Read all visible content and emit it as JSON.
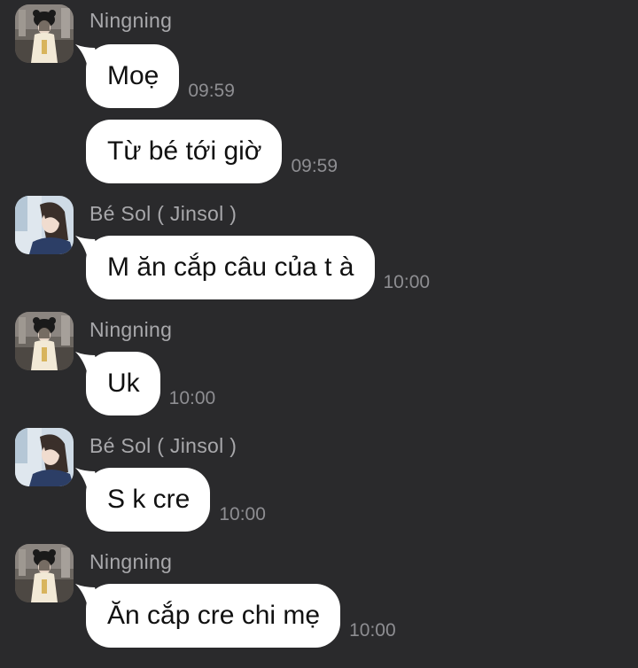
{
  "colors": {
    "background": "#2a2a2c",
    "bubble": "#ffffff",
    "bubble_text": "#111111",
    "sender_text": "#a8a8ab",
    "time_text": "#8e8e92"
  },
  "messages": [
    {
      "sender": "Ningning",
      "avatar": "ningning-avatar",
      "text": "Moẹ",
      "time": "09:59"
    },
    {
      "text": "Từ bé tới giờ",
      "time": "09:59"
    },
    {
      "sender": "Bé Sol ( Jinsol )",
      "avatar": "jinsol-avatar",
      "text": "M ăn cắp câu của t à",
      "time": "10:00"
    },
    {
      "sender": "Ningning",
      "avatar": "ningning-avatar",
      "text": "Uk",
      "time": "10:00"
    },
    {
      "sender": "Bé Sol ( Jinsol )",
      "avatar": "jinsol-avatar",
      "text": "S k cre",
      "time": "10:00"
    },
    {
      "sender": "Ningning",
      "avatar": "ningning-avatar",
      "text": "Ăn cắp cre chi mẹ",
      "time": "10:00"
    }
  ]
}
